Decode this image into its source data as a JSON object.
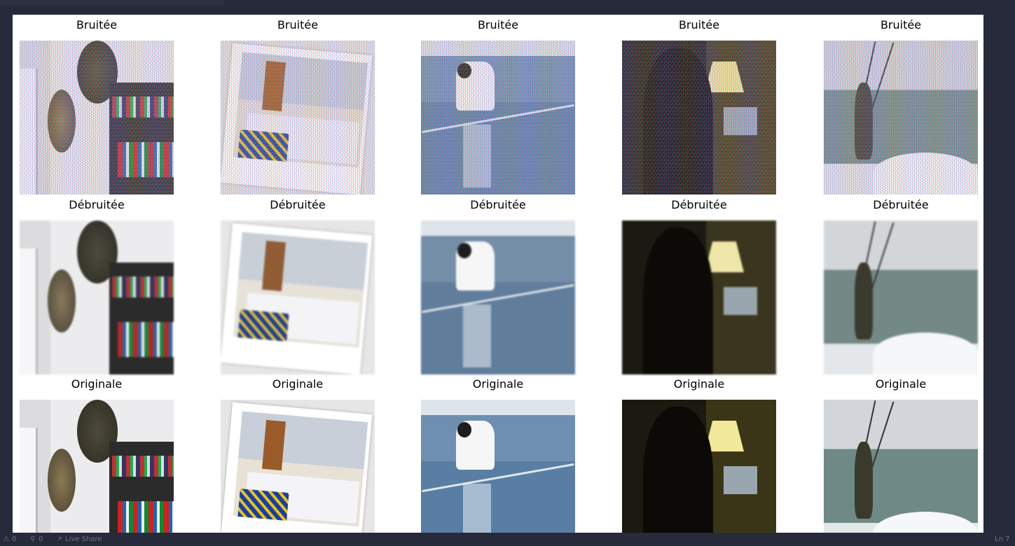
{
  "grid": {
    "rows": [
      {
        "label_key": "noisy",
        "cells": [
          {
            "caption": "Bruitée",
            "scene": "wall-plates-bookshelf"
          },
          {
            "caption": "Bruitée",
            "scene": "polaroid-bedroom"
          },
          {
            "caption": "Bruitée",
            "scene": "dog-on-ice"
          },
          {
            "caption": "Bruitée",
            "scene": "person-lamp-laptop"
          },
          {
            "caption": "Bruitée",
            "scene": "kitesurfer"
          }
        ]
      },
      {
        "label_key": "denoised",
        "cells": [
          {
            "caption": "Débruitée",
            "scene": "wall-plates-bookshelf"
          },
          {
            "caption": "Débruitée",
            "scene": "polaroid-bedroom"
          },
          {
            "caption": "Débruitée",
            "scene": "dog-on-ice"
          },
          {
            "caption": "Débruitée",
            "scene": "person-lamp-laptop"
          },
          {
            "caption": "Débruitée",
            "scene": "kitesurfer"
          }
        ]
      },
      {
        "label_key": "original",
        "cells": [
          {
            "caption": "Originale",
            "scene": "wall-plates-bookshelf"
          },
          {
            "caption": "Originale",
            "scene": "polaroid-bedroom"
          },
          {
            "caption": "Originale",
            "scene": "dog-on-ice"
          },
          {
            "caption": "Originale",
            "scene": "person-lamp-laptop"
          },
          {
            "caption": "Originale",
            "scene": "kitesurfer"
          }
        ]
      }
    ]
  },
  "statusbar": {
    "problems": "0",
    "warnings": "0",
    "live_share": "Live Share",
    "cursor": "Ln 7"
  },
  "colors": {
    "editor_bg": "#262a3b",
    "panel_bg": "#ffffff",
    "statusbar_fg": "#6f7389"
  },
  "icons": {
    "problems": "warning-icon",
    "warnings": "radio-tower-icon",
    "live_share": "live-share-icon"
  }
}
